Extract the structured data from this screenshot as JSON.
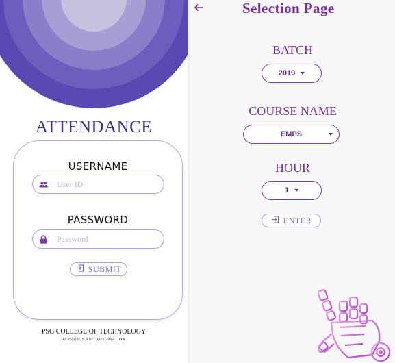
{
  "login": {
    "title": "ATTENDANCE",
    "username_label": "USERNAME",
    "username_placeholder": "User ID",
    "username_icon": "people-icon",
    "password_label": "PASSWORD",
    "password_placeholder": "Password",
    "password_icon": "lock-icon",
    "submit_label": "SUBMIT",
    "submit_icon": "login-icon",
    "college_name": "PSG COLLEGE OF TECHNOLOGY",
    "department": "ROBOTICS AND AUTOMATION"
  },
  "selection": {
    "back_icon": "arrow-left-icon",
    "title": "Selection Page",
    "batch_label": "BATCH",
    "batch_value": "2019",
    "course_label": "COURSE NAME",
    "course_value": "EMPS",
    "hour_label": "HOUR",
    "hour_value": "1",
    "enter_label": "ENTER",
    "enter_icon": "login-icon",
    "illustration": "robot-hand-icon"
  },
  "colors": {
    "title_blue": "#3d2f9c",
    "accent_purple": "#7b2d9b",
    "ring_outer": "#5b48b2",
    "ring_inner": "#c7c1dd",
    "border_lavender": "#b09ce6",
    "robot_pink": "#d66fe0"
  }
}
